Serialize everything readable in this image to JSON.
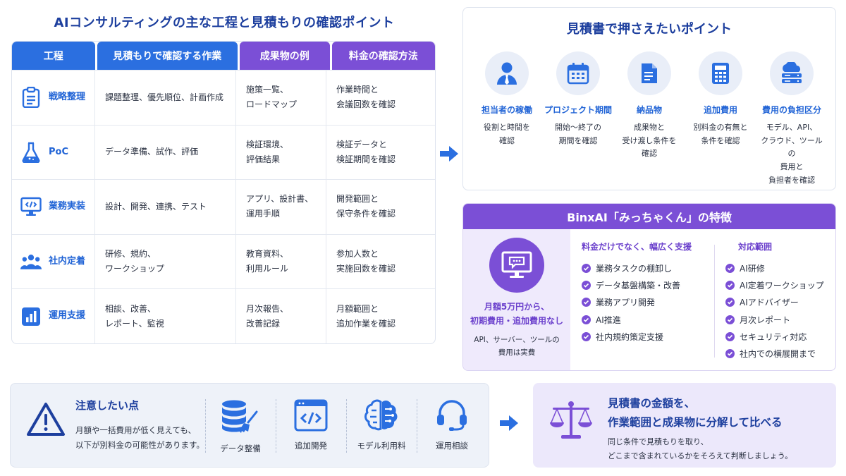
{
  "main_title": "AIコンサルティングの主な工程と見積もりの確認ポイント",
  "table": {
    "headers": [
      "工程",
      "見積もりで確認する作業",
      "成果物の例",
      "料金の確認方法"
    ],
    "rows": [
      {
        "icon": "clipboard-icon",
        "process": "戦略整理",
        "work": "課題整理、優先順位、計画作成",
        "deliverable": "施策一覧、\nロードマップ",
        "pricing": "作業時間と\n会議回数を確認"
      },
      {
        "icon": "flask-icon",
        "process": "PoC",
        "work": "データ準備、試作、評価",
        "deliverable": "検証環境、\n評価結果",
        "pricing": "検証データと\n検証期間を確認"
      },
      {
        "icon": "code-monitor-icon",
        "process": "業務実装",
        "work": "設計、開発、連携、テスト",
        "deliverable": "アプリ、設計書、\n運用手順",
        "pricing": "開発範囲と\n保守条件を確認"
      },
      {
        "icon": "people-icon",
        "process": "社内定着",
        "work": "研修、規約、\nワークショップ",
        "deliverable": "教育資料、\n利用ルール",
        "pricing": "参加人数と\n実施回数を確認"
      },
      {
        "icon": "bar-chart-icon",
        "process": "運用支援",
        "work": "相談、改善、\nレポート、監視",
        "deliverable": "月次報告、\n改善記録",
        "pricing": "月額範囲と\n追加作業を確認"
      }
    ]
  },
  "points": {
    "title": "見積書で押さえたいポイント",
    "items": [
      {
        "icon": "person-icon",
        "title": "担当者の稼働",
        "desc": "役割と時間を\n確認"
      },
      {
        "icon": "calendar-icon",
        "title": "プロジェクト期間",
        "desc": "開始〜終了の\n期間を確認"
      },
      {
        "icon": "document-icon",
        "title": "納品物",
        "desc": "成果物と\n受け渡し条件を\n確認"
      },
      {
        "icon": "calculator-icon",
        "title": "追加費用",
        "desc": "別料金の有無と\n条件を確認"
      },
      {
        "icon": "cloud-server-icon",
        "title": "費用の負担区分",
        "desc": "モデル、API、\nクラウド、ツールの\n費用と\n負担者を確認"
      }
    ]
  },
  "features": {
    "title": "BinxAI「みっちゃくん」の特徴",
    "price": "月額5万円から、\n初期費用・追加費用なし",
    "price_note": "API、サーバー、ツールの\n費用は実費",
    "support_title": "料金だけでなく、幅広く支援",
    "support_items": [
      "業務タスクの棚卸し",
      "データ基盤構築・改善",
      "業務アプリ開発",
      "AI推進",
      "社内規約策定支援"
    ],
    "scope_title": "対応範囲",
    "scope_items": [
      "AI研修",
      "AI定着ワークショップ",
      "AIアドバイザー",
      "月次レポート",
      "セキュリティ対応",
      "社内での横展開まで"
    ]
  },
  "caution": {
    "title": "注意したい点",
    "text": "月額や一括費用が低く見えても、\n以下が別料金の可能性があります。",
    "costs": [
      {
        "icon": "database-icon",
        "label": "データ整備"
      },
      {
        "icon": "code-window-icon",
        "label": "追加開発"
      },
      {
        "icon": "ai-brain-icon",
        "label": "モデル利用料"
      },
      {
        "icon": "headset-icon",
        "label": "運用相談"
      }
    ]
  },
  "compare": {
    "title": "見積書の金額を、\n作業範囲と成果物に分解して比べる",
    "sub": "同じ条件で見積もりを取り、\nどこまで含まれているかをそろえて判断しましょう。"
  },
  "colors": {
    "blue": "#2b6fe0",
    "purple": "#7b4fd6",
    "navy": "#1d3f9e"
  }
}
